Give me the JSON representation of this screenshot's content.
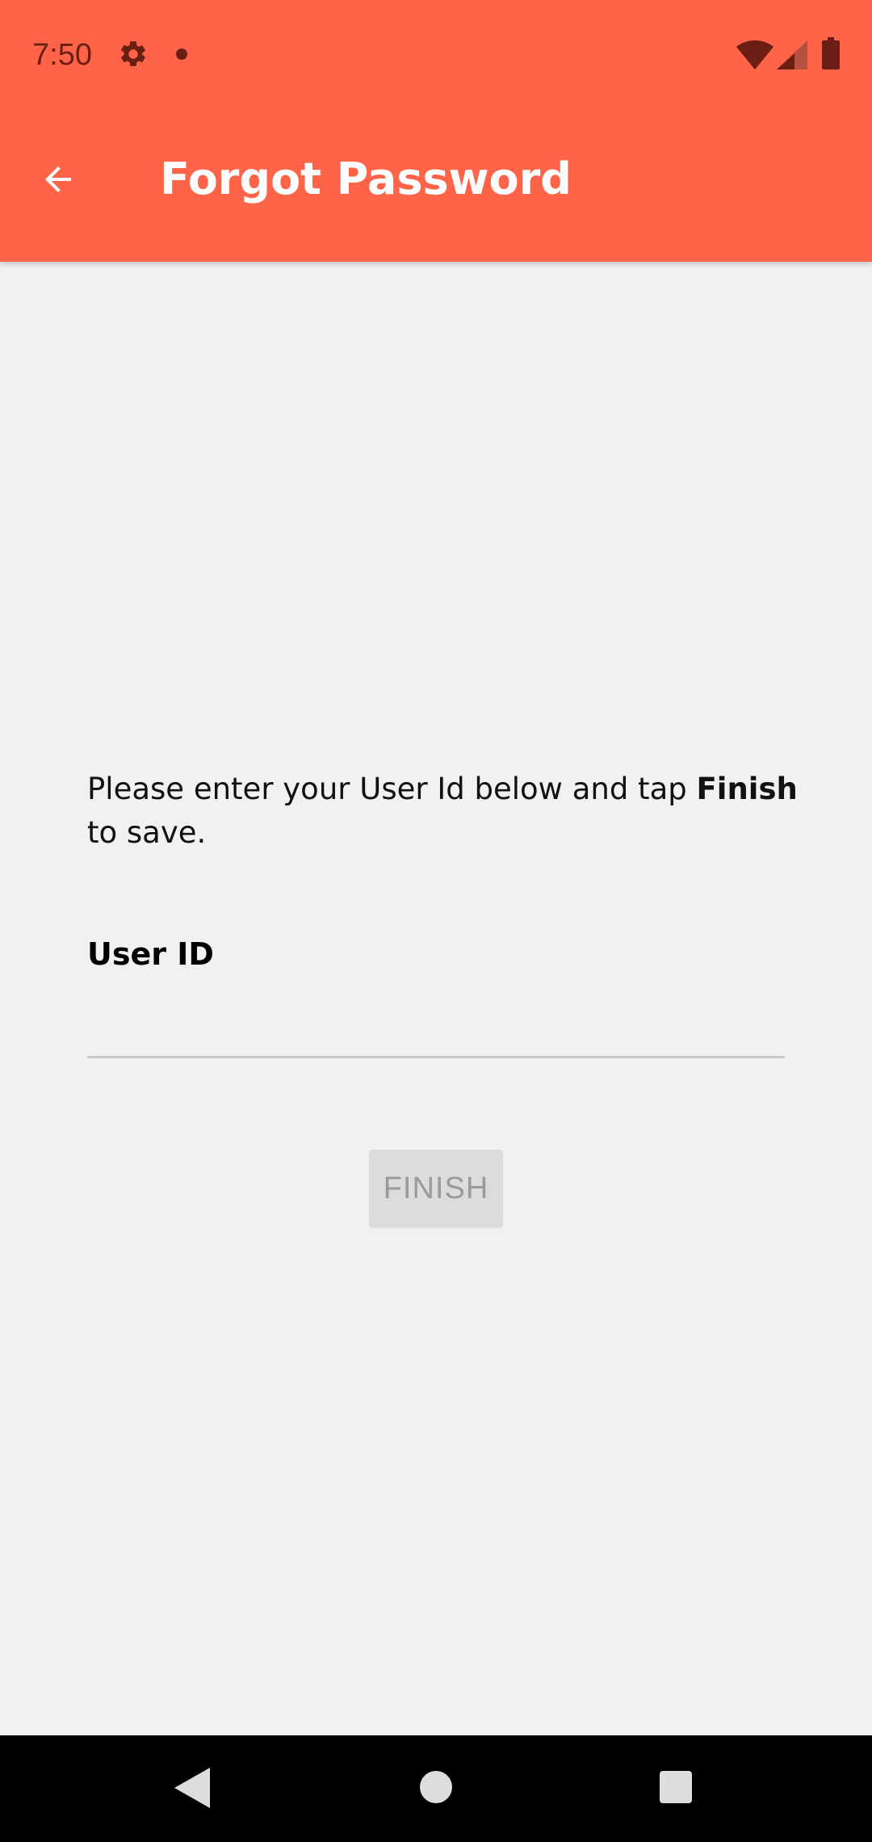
{
  "status_bar": {
    "time": "7:50",
    "icons": [
      "gear-icon",
      "notification-dot-icon",
      "wifi-icon",
      "signal-icon",
      "battery-icon"
    ]
  },
  "app_bar": {
    "title": "Forgot Password",
    "back_icon": "arrow-left-icon"
  },
  "form": {
    "instructions_before": "Please enter your User Id below and tap ",
    "instructions_bold": "Finish",
    "instructions_after": " to save.",
    "userid_label": "User ID",
    "userid_value": "",
    "finish_label": "FINISH"
  },
  "nav_bar": {
    "icons": [
      "back-triangle-icon",
      "home-circle-icon",
      "recents-square-icon"
    ]
  },
  "colors": {
    "accent": "#ff6449",
    "background": "#f1f1f1",
    "status_icons": "#6b1f14",
    "button_disabled_bg": "#dcdcdc",
    "button_disabled_text": "#9a9a9a"
  }
}
